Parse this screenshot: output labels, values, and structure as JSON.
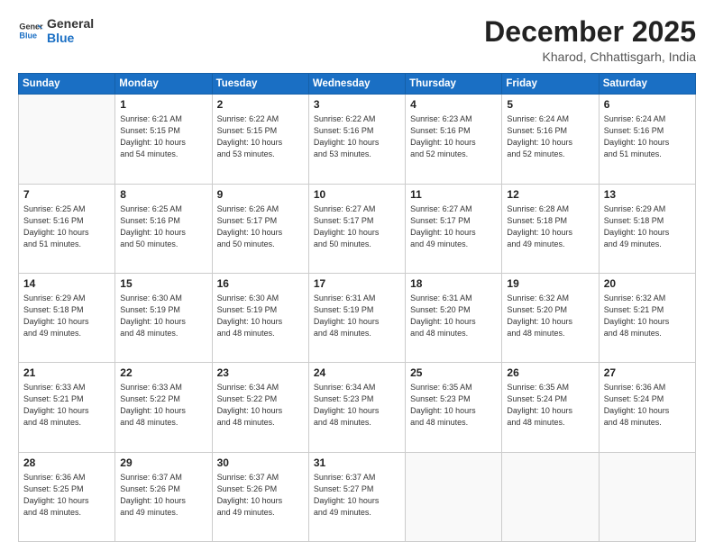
{
  "header": {
    "logo_line1": "General",
    "logo_line2": "Blue",
    "month": "December 2025",
    "location": "Kharod, Chhattisgarh, India"
  },
  "days": [
    "Sunday",
    "Monday",
    "Tuesday",
    "Wednesday",
    "Thursday",
    "Friday",
    "Saturday"
  ],
  "weeks": [
    [
      {
        "day": "",
        "info": ""
      },
      {
        "day": "1",
        "info": "Sunrise: 6:21 AM\nSunset: 5:15 PM\nDaylight: 10 hours\nand 54 minutes."
      },
      {
        "day": "2",
        "info": "Sunrise: 6:22 AM\nSunset: 5:15 PM\nDaylight: 10 hours\nand 53 minutes."
      },
      {
        "day": "3",
        "info": "Sunrise: 6:22 AM\nSunset: 5:16 PM\nDaylight: 10 hours\nand 53 minutes."
      },
      {
        "day": "4",
        "info": "Sunrise: 6:23 AM\nSunset: 5:16 PM\nDaylight: 10 hours\nand 52 minutes."
      },
      {
        "day": "5",
        "info": "Sunrise: 6:24 AM\nSunset: 5:16 PM\nDaylight: 10 hours\nand 52 minutes."
      },
      {
        "day": "6",
        "info": "Sunrise: 6:24 AM\nSunset: 5:16 PM\nDaylight: 10 hours\nand 51 minutes."
      }
    ],
    [
      {
        "day": "7",
        "info": "Sunrise: 6:25 AM\nSunset: 5:16 PM\nDaylight: 10 hours\nand 51 minutes."
      },
      {
        "day": "8",
        "info": "Sunrise: 6:25 AM\nSunset: 5:16 PM\nDaylight: 10 hours\nand 50 minutes."
      },
      {
        "day": "9",
        "info": "Sunrise: 6:26 AM\nSunset: 5:17 PM\nDaylight: 10 hours\nand 50 minutes."
      },
      {
        "day": "10",
        "info": "Sunrise: 6:27 AM\nSunset: 5:17 PM\nDaylight: 10 hours\nand 50 minutes."
      },
      {
        "day": "11",
        "info": "Sunrise: 6:27 AM\nSunset: 5:17 PM\nDaylight: 10 hours\nand 49 minutes."
      },
      {
        "day": "12",
        "info": "Sunrise: 6:28 AM\nSunset: 5:18 PM\nDaylight: 10 hours\nand 49 minutes."
      },
      {
        "day": "13",
        "info": "Sunrise: 6:29 AM\nSunset: 5:18 PM\nDaylight: 10 hours\nand 49 minutes."
      }
    ],
    [
      {
        "day": "14",
        "info": "Sunrise: 6:29 AM\nSunset: 5:18 PM\nDaylight: 10 hours\nand 49 minutes."
      },
      {
        "day": "15",
        "info": "Sunrise: 6:30 AM\nSunset: 5:19 PM\nDaylight: 10 hours\nand 48 minutes."
      },
      {
        "day": "16",
        "info": "Sunrise: 6:30 AM\nSunset: 5:19 PM\nDaylight: 10 hours\nand 48 minutes."
      },
      {
        "day": "17",
        "info": "Sunrise: 6:31 AM\nSunset: 5:19 PM\nDaylight: 10 hours\nand 48 minutes."
      },
      {
        "day": "18",
        "info": "Sunrise: 6:31 AM\nSunset: 5:20 PM\nDaylight: 10 hours\nand 48 minutes."
      },
      {
        "day": "19",
        "info": "Sunrise: 6:32 AM\nSunset: 5:20 PM\nDaylight: 10 hours\nand 48 minutes."
      },
      {
        "day": "20",
        "info": "Sunrise: 6:32 AM\nSunset: 5:21 PM\nDaylight: 10 hours\nand 48 minutes."
      }
    ],
    [
      {
        "day": "21",
        "info": "Sunrise: 6:33 AM\nSunset: 5:21 PM\nDaylight: 10 hours\nand 48 minutes."
      },
      {
        "day": "22",
        "info": "Sunrise: 6:33 AM\nSunset: 5:22 PM\nDaylight: 10 hours\nand 48 minutes."
      },
      {
        "day": "23",
        "info": "Sunrise: 6:34 AM\nSunset: 5:22 PM\nDaylight: 10 hours\nand 48 minutes."
      },
      {
        "day": "24",
        "info": "Sunrise: 6:34 AM\nSunset: 5:23 PM\nDaylight: 10 hours\nand 48 minutes."
      },
      {
        "day": "25",
        "info": "Sunrise: 6:35 AM\nSunset: 5:23 PM\nDaylight: 10 hours\nand 48 minutes."
      },
      {
        "day": "26",
        "info": "Sunrise: 6:35 AM\nSunset: 5:24 PM\nDaylight: 10 hours\nand 48 minutes."
      },
      {
        "day": "27",
        "info": "Sunrise: 6:36 AM\nSunset: 5:24 PM\nDaylight: 10 hours\nand 48 minutes."
      }
    ],
    [
      {
        "day": "28",
        "info": "Sunrise: 6:36 AM\nSunset: 5:25 PM\nDaylight: 10 hours\nand 48 minutes."
      },
      {
        "day": "29",
        "info": "Sunrise: 6:37 AM\nSunset: 5:26 PM\nDaylight: 10 hours\nand 49 minutes."
      },
      {
        "day": "30",
        "info": "Sunrise: 6:37 AM\nSunset: 5:26 PM\nDaylight: 10 hours\nand 49 minutes."
      },
      {
        "day": "31",
        "info": "Sunrise: 6:37 AM\nSunset: 5:27 PM\nDaylight: 10 hours\nand 49 minutes."
      },
      {
        "day": "",
        "info": ""
      },
      {
        "day": "",
        "info": ""
      },
      {
        "day": "",
        "info": ""
      }
    ]
  ]
}
